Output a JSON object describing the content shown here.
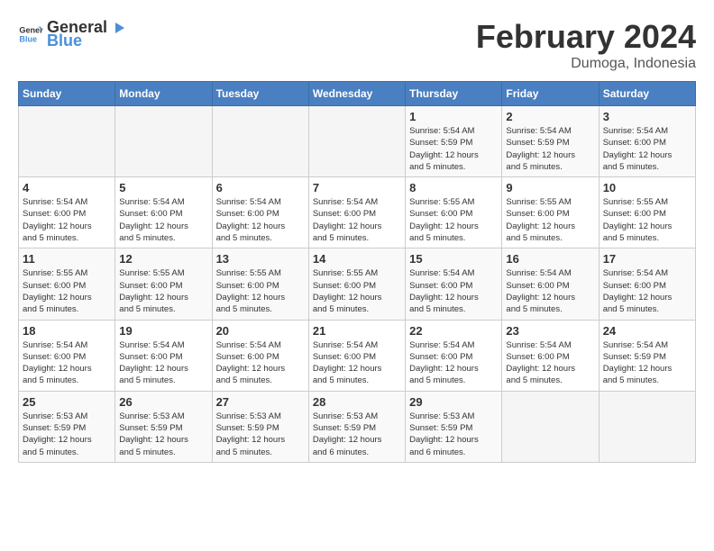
{
  "header": {
    "logo_general": "General",
    "logo_blue": "Blue",
    "title": "February 2024",
    "subtitle": "Dumoga, Indonesia"
  },
  "days_of_week": [
    "Sunday",
    "Monday",
    "Tuesday",
    "Wednesday",
    "Thursday",
    "Friday",
    "Saturday"
  ],
  "weeks": [
    [
      {
        "day": "",
        "info": ""
      },
      {
        "day": "",
        "info": ""
      },
      {
        "day": "",
        "info": ""
      },
      {
        "day": "",
        "info": ""
      },
      {
        "day": "1",
        "info": "Sunrise: 5:54 AM\nSunset: 5:59 PM\nDaylight: 12 hours\nand 5 minutes."
      },
      {
        "day": "2",
        "info": "Sunrise: 5:54 AM\nSunset: 5:59 PM\nDaylight: 12 hours\nand 5 minutes."
      },
      {
        "day": "3",
        "info": "Sunrise: 5:54 AM\nSunset: 6:00 PM\nDaylight: 12 hours\nand 5 minutes."
      }
    ],
    [
      {
        "day": "4",
        "info": "Sunrise: 5:54 AM\nSunset: 6:00 PM\nDaylight: 12 hours\nand 5 minutes."
      },
      {
        "day": "5",
        "info": "Sunrise: 5:54 AM\nSunset: 6:00 PM\nDaylight: 12 hours\nand 5 minutes."
      },
      {
        "day": "6",
        "info": "Sunrise: 5:54 AM\nSunset: 6:00 PM\nDaylight: 12 hours\nand 5 minutes."
      },
      {
        "day": "7",
        "info": "Sunrise: 5:54 AM\nSunset: 6:00 PM\nDaylight: 12 hours\nand 5 minutes."
      },
      {
        "day": "8",
        "info": "Sunrise: 5:55 AM\nSunset: 6:00 PM\nDaylight: 12 hours\nand 5 minutes."
      },
      {
        "day": "9",
        "info": "Sunrise: 5:55 AM\nSunset: 6:00 PM\nDaylight: 12 hours\nand 5 minutes."
      },
      {
        "day": "10",
        "info": "Sunrise: 5:55 AM\nSunset: 6:00 PM\nDaylight: 12 hours\nand 5 minutes."
      }
    ],
    [
      {
        "day": "11",
        "info": "Sunrise: 5:55 AM\nSunset: 6:00 PM\nDaylight: 12 hours\nand 5 minutes."
      },
      {
        "day": "12",
        "info": "Sunrise: 5:55 AM\nSunset: 6:00 PM\nDaylight: 12 hours\nand 5 minutes."
      },
      {
        "day": "13",
        "info": "Sunrise: 5:55 AM\nSunset: 6:00 PM\nDaylight: 12 hours\nand 5 minutes."
      },
      {
        "day": "14",
        "info": "Sunrise: 5:55 AM\nSunset: 6:00 PM\nDaylight: 12 hours\nand 5 minutes."
      },
      {
        "day": "15",
        "info": "Sunrise: 5:54 AM\nSunset: 6:00 PM\nDaylight: 12 hours\nand 5 minutes."
      },
      {
        "day": "16",
        "info": "Sunrise: 5:54 AM\nSunset: 6:00 PM\nDaylight: 12 hours\nand 5 minutes."
      },
      {
        "day": "17",
        "info": "Sunrise: 5:54 AM\nSunset: 6:00 PM\nDaylight: 12 hours\nand 5 minutes."
      }
    ],
    [
      {
        "day": "18",
        "info": "Sunrise: 5:54 AM\nSunset: 6:00 PM\nDaylight: 12 hours\nand 5 minutes."
      },
      {
        "day": "19",
        "info": "Sunrise: 5:54 AM\nSunset: 6:00 PM\nDaylight: 12 hours\nand 5 minutes."
      },
      {
        "day": "20",
        "info": "Sunrise: 5:54 AM\nSunset: 6:00 PM\nDaylight: 12 hours\nand 5 minutes."
      },
      {
        "day": "21",
        "info": "Sunrise: 5:54 AM\nSunset: 6:00 PM\nDaylight: 12 hours\nand 5 minutes."
      },
      {
        "day": "22",
        "info": "Sunrise: 5:54 AM\nSunset: 6:00 PM\nDaylight: 12 hours\nand 5 minutes."
      },
      {
        "day": "23",
        "info": "Sunrise: 5:54 AM\nSunset: 6:00 PM\nDaylight: 12 hours\nand 5 minutes."
      },
      {
        "day": "24",
        "info": "Sunrise: 5:54 AM\nSunset: 5:59 PM\nDaylight: 12 hours\nand 5 minutes."
      }
    ],
    [
      {
        "day": "25",
        "info": "Sunrise: 5:53 AM\nSunset: 5:59 PM\nDaylight: 12 hours\nand 5 minutes."
      },
      {
        "day": "26",
        "info": "Sunrise: 5:53 AM\nSunset: 5:59 PM\nDaylight: 12 hours\nand 5 minutes."
      },
      {
        "day": "27",
        "info": "Sunrise: 5:53 AM\nSunset: 5:59 PM\nDaylight: 12 hours\nand 5 minutes."
      },
      {
        "day": "28",
        "info": "Sunrise: 5:53 AM\nSunset: 5:59 PM\nDaylight: 12 hours\nand 6 minutes."
      },
      {
        "day": "29",
        "info": "Sunrise: 5:53 AM\nSunset: 5:59 PM\nDaylight: 12 hours\nand 6 minutes."
      },
      {
        "day": "",
        "info": ""
      },
      {
        "day": "",
        "info": ""
      }
    ]
  ]
}
